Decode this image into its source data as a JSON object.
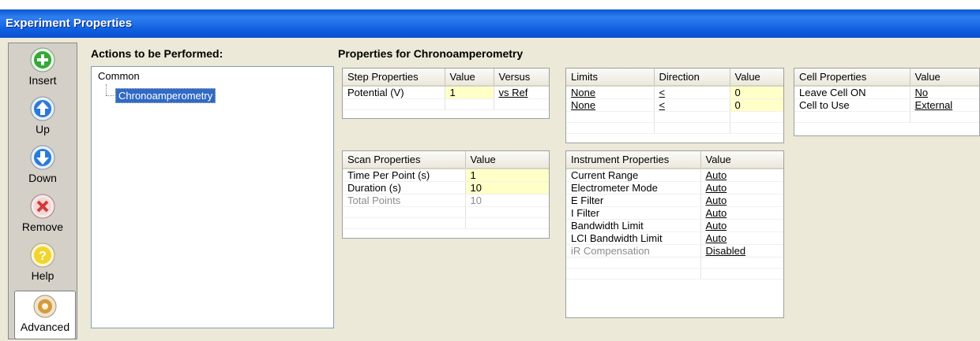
{
  "window": {
    "title": "Experiment Properties"
  },
  "toolbar": {
    "items": [
      {
        "label": "Insert",
        "icon": "plus-icon",
        "color": "#2fa82f"
      },
      {
        "label": "Up",
        "icon": "arrow-up-icon",
        "color": "#2a7ad8"
      },
      {
        "label": "Down",
        "icon": "arrow-down-icon",
        "color": "#2a7ad8"
      },
      {
        "label": "Remove",
        "icon": "x-icon",
        "color": "#d23a3a"
      },
      {
        "label": "Help",
        "icon": "question-icon",
        "color": "#e8c81a"
      },
      {
        "label": "Advanced",
        "icon": "gear-icon",
        "color": "#d79a3a"
      }
    ]
  },
  "actions": {
    "heading": "Actions to be Performed:",
    "root": "Common",
    "selected": "Chronoamperometry"
  },
  "properties": {
    "heading": "Properties for Chronoamperometry",
    "step": {
      "headers": [
        "Step Properties",
        "Value",
        "Versus"
      ],
      "rows": [
        [
          "Potential (V)",
          "1",
          "vs Ref"
        ]
      ]
    },
    "limits": {
      "headers": [
        "Limits",
        "Direction",
        "Value"
      ],
      "rows": [
        [
          "None",
          "<",
          "0"
        ],
        [
          "None",
          "<",
          "0"
        ]
      ]
    },
    "cell": {
      "headers": [
        "Cell Properties",
        "Value"
      ],
      "rows": [
        [
          "Leave Cell ON",
          "No"
        ],
        [
          "Cell to Use",
          "External"
        ]
      ]
    },
    "scan": {
      "headers": [
        "Scan Properties",
        "Value"
      ],
      "rows": [
        [
          "Time Per Point (s)",
          "1"
        ],
        [
          "Duration (s)",
          "10"
        ],
        [
          "Total Points",
          "10"
        ]
      ]
    },
    "instrument": {
      "headers": [
        "Instrument Properties",
        "Value"
      ],
      "rows": [
        [
          "Current Range",
          "Auto"
        ],
        [
          "Electrometer Mode",
          "Auto"
        ],
        [
          "E Filter",
          "Auto"
        ],
        [
          "I Filter",
          "Auto"
        ],
        [
          "Bandwidth Limit",
          "Auto"
        ],
        [
          "LCI Bandwidth Limit",
          "Auto"
        ],
        [
          "iR Compensation",
          "Disabled"
        ]
      ]
    }
  },
  "colors": {
    "titlebar": "#0a59d4",
    "selection": "#316ac5",
    "editable_cell": "#ffffc8"
  }
}
